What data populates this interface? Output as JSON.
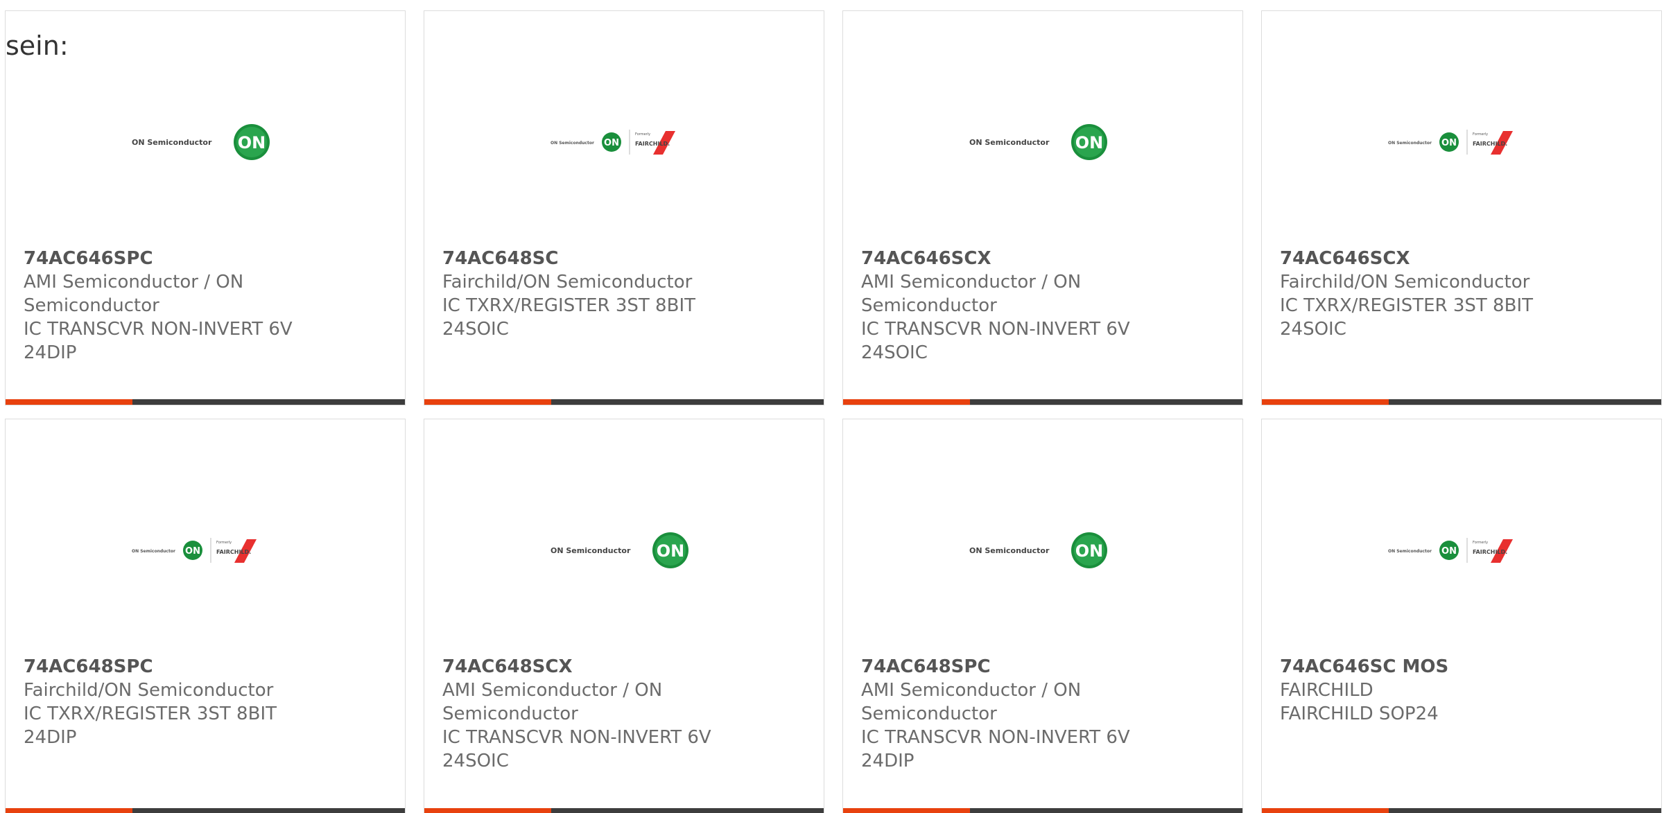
{
  "intro_text": "sein:",
  "logos": {
    "on": {
      "text": "ON Semiconductor",
      "badge": "ON",
      "icon": "on-semiconductor-logo"
    },
    "fairchild": {
      "text": "ON Semiconductor",
      "badge": "ON",
      "formerly": "Formerly",
      "brand": "FAIRCHILD.",
      "icon": "on-fairchild-logo"
    }
  },
  "colors": {
    "accent": "#e8410e",
    "bar": "#3d3d3d",
    "on_green": "#1a8f3c",
    "fairchild_red": "#e8302f"
  },
  "products": [
    {
      "part": "74AC646SPC",
      "lines": [
        "AMI Semiconductor / ON",
        "Semiconductor",
        "IC TRANSCVR NON-INVERT 6V",
        "24DIP"
      ],
      "logo": "on"
    },
    {
      "part": "74AC648SC",
      "lines": [
        "Fairchild/ON Semiconductor",
        "IC TXRX/REGISTER 3ST 8BIT",
        "24SOIC"
      ],
      "logo": "fairchild"
    },
    {
      "part": "74AC646SCX",
      "lines": [
        "AMI Semiconductor / ON",
        "Semiconductor",
        "IC TRANSCVR NON-INVERT 6V",
        "24SOIC"
      ],
      "logo": "on"
    },
    {
      "part": "74AC646SCX",
      "lines": [
        "Fairchild/ON Semiconductor",
        "IC TXRX/REGISTER 3ST 8BIT",
        "24SOIC"
      ],
      "logo": "fairchild"
    },
    {
      "part": "74AC648SPC",
      "lines": [
        "Fairchild/ON Semiconductor",
        "IC TXRX/REGISTER 3ST 8BIT",
        "24DIP"
      ],
      "logo": "fairchild"
    },
    {
      "part": "74AC648SCX",
      "lines": [
        "AMI Semiconductor / ON",
        "Semiconductor",
        "IC TRANSCVR NON-INVERT 6V",
        "24SOIC"
      ],
      "logo": "on"
    },
    {
      "part": "74AC648SPC",
      "lines": [
        "AMI Semiconductor / ON",
        "Semiconductor",
        "IC TRANSCVR NON-INVERT 6V",
        "24DIP"
      ],
      "logo": "on"
    },
    {
      "part": "74AC646SC MOS",
      "lines": [
        "FAIRCHILD",
        "FAIRCHILD SOP24"
      ],
      "logo": "fairchild"
    }
  ]
}
